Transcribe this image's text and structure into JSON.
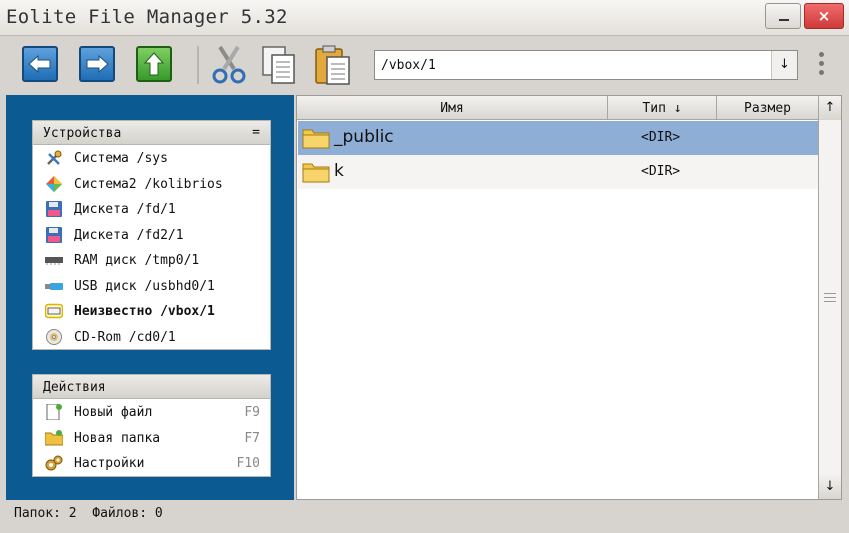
{
  "window": {
    "title": "Eolite File Manager 5.32",
    "close_glyph": "×"
  },
  "toolbar": {
    "path": "/vbox/1",
    "path_dropdown_glyph": "↓",
    "buttons": [
      "back-icon",
      "forward-icon",
      "up-icon",
      "cut-icon",
      "copy-icon",
      "paste-icon"
    ]
  },
  "devices": {
    "header": "Устройства",
    "collapse_glyph": "=",
    "items": [
      {
        "label": "Система /sys",
        "icon": "system-tools-icon"
      },
      {
        "label": "Система2 /kolibrios",
        "icon": "kolibrios-diamond-icon"
      },
      {
        "label": "Дискета /fd/1",
        "icon": "floppy-icon"
      },
      {
        "label": "Дискета /fd2/1",
        "icon": "floppy-icon"
      },
      {
        "label": "RAM диск /tmp0/1",
        "icon": "ram-icon"
      },
      {
        "label": "USB диск /usbhd0/1",
        "icon": "usb-icon"
      },
      {
        "label": "Неизвестно /vbox/1",
        "icon": "unknown-drive-icon",
        "active": true
      },
      {
        "label": "CD-Rom /cd0/1",
        "icon": "cd-icon"
      }
    ]
  },
  "actions": {
    "header": "Действия",
    "items": [
      {
        "label": "Новый файл",
        "key": "F9",
        "icon": "new-file-icon"
      },
      {
        "label": "Новая папка",
        "key": "F7",
        "icon": "new-folder-icon"
      },
      {
        "label": "Настройки",
        "key": "F10",
        "icon": "settings-gears-icon"
      }
    ]
  },
  "file_list": {
    "columns": {
      "name": "Имя",
      "type": "Тип ↓",
      "size": "Размер"
    },
    "scroll_up": "↑",
    "scroll_down": "↓",
    "rows": [
      {
        "name": "_public",
        "type": "<DIR>",
        "selected": true
      },
      {
        "name": "k",
        "type": "<DIR>",
        "selected": false
      }
    ]
  },
  "status": {
    "text": "Папок: 2  Файлов: 0"
  },
  "colors": {
    "panel_blue": "#0c5a92",
    "selection": "#8eaed6",
    "close_red": "#d03a3a"
  }
}
